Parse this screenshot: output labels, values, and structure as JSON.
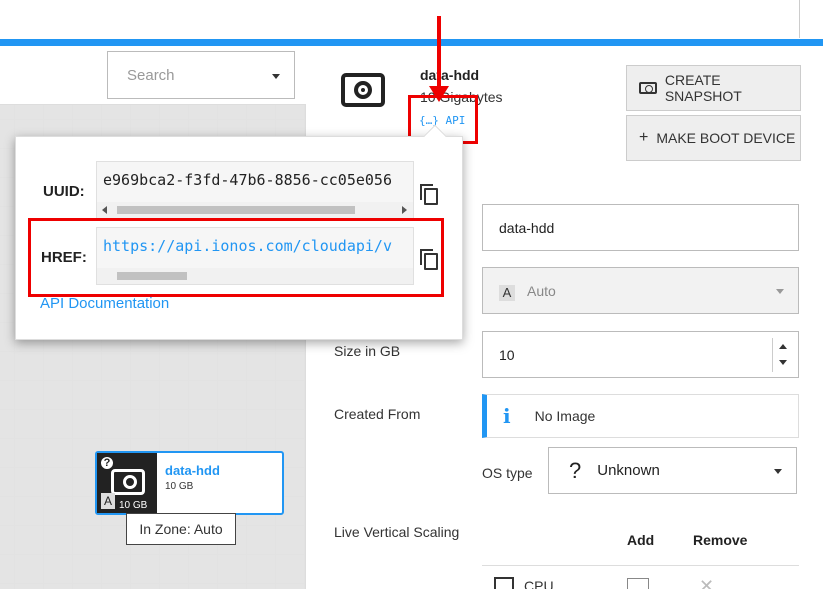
{
  "search": {
    "placeholder": "Search"
  },
  "canvas": {
    "node": {
      "name": "data-hdd",
      "size": "10 GB",
      "size_badge": "10 GB",
      "badge_q": "?",
      "badge_a": "A"
    },
    "tooltip": "In Zone: Auto"
  },
  "popover": {
    "uuid_label": "UUID:",
    "uuid_value": "e969bca2-f3fd-47b6-8856-cc05e056",
    "href_label": "HREF:",
    "href_value": "https://api.ionos.com/cloudapi/v",
    "api_doc_link": "API Documentation"
  },
  "header": {
    "title": "data-hdd",
    "size": "10 Gigabytes",
    "api_link": "{…} API",
    "create_snapshot": "CREATE SNAPSHOT",
    "make_boot_device": "MAKE BOOT DEVICE"
  },
  "form": {
    "name_value": "data-hdd",
    "zone_value": "Auto",
    "zone_badge": "A",
    "size_label": "Size in GB",
    "size_value": "10",
    "created_from_label": "Created From",
    "created_from_value": "No Image",
    "os_type_label": "OS type",
    "os_type_value": "Unknown",
    "live_scaling_label": "Live Vertical Scaling",
    "col_add": "Add",
    "col_remove": "Remove",
    "cpu_label": "CPU"
  },
  "colors": {
    "accent": "#2196f3",
    "highlight": "#e00000"
  }
}
